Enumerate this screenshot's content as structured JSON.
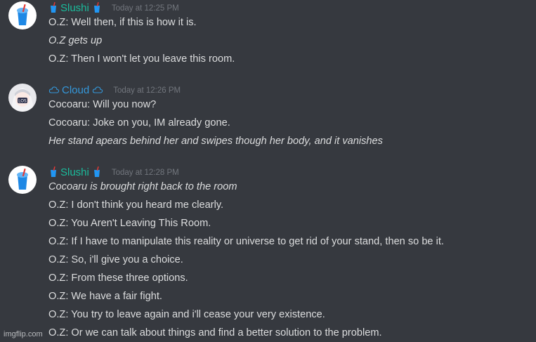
{
  "colors": {
    "background": "#36393f",
    "message_text": "#dcddde",
    "timestamp": "#72767d",
    "slushi_name": "#1abc9c",
    "cloud_name": "#3498db"
  },
  "messages": [
    {
      "author": "Slushi",
      "author_icon": "slushie-cup-icon",
      "timestamp": "Today at 12:25 PM",
      "lines": [
        {
          "text": "O.Z: Well then, if this is how it is.",
          "italic": false
        },
        {
          "text": "O.Z gets up",
          "italic": true
        },
        {
          "text": "O.Z: Then I won't let you leave this room.",
          "italic": false
        }
      ]
    },
    {
      "author": "Cloud",
      "author_icon": "cloud-outline-icon",
      "timestamp": "Today at 12:26 PM",
      "lines": [
        {
          "text": "Cocoaru: Will you now?",
          "italic": false
        },
        {
          "text": "Cocoaru: Joke on you, IM already gone.",
          "italic": false
        },
        {
          "text": "Her stand apears behind her and swipes though her body, and it vanishes",
          "italic": true
        }
      ]
    },
    {
      "author": "Slushi",
      "author_icon": "slushie-cup-icon",
      "timestamp": "Today at 12:28 PM",
      "lines": [
        {
          "text": "Cocoaru is brought right back to the room",
          "italic": true
        },
        {
          "text": "O.Z: I don't think you heard me clearly.",
          "italic": false
        },
        {
          "text": "O.Z: You Aren't Leaving This Room.",
          "italic": false
        },
        {
          "text": "O.Z: If I have to manipulate this reality or universe to get rid of your stand, then so be it.",
          "italic": false
        },
        {
          "text": "O.Z: So, i'll give you a choice.",
          "italic": false
        },
        {
          "text": "O.Z: From these three options.",
          "italic": false
        },
        {
          "text": "O.Z: We have a fair fight.",
          "italic": false
        },
        {
          "text": "O.Z: You try to leave again and i'll cease your very existence.",
          "italic": false
        },
        {
          "text": "O.Z: Or we can talk about things and find a better solution to the problem.",
          "italic": false
        }
      ]
    }
  ],
  "watermark": "imgflip.com"
}
